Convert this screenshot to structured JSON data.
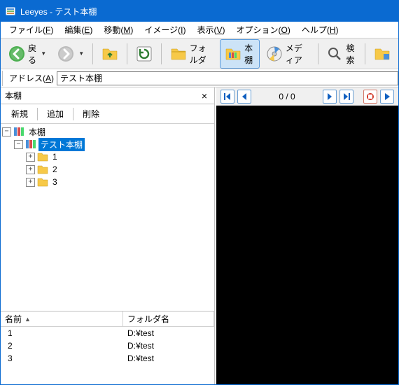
{
  "titlebar": {
    "title": "Leeyes - テスト本棚"
  },
  "menubar": {
    "file": "ファイル(",
    "file_u": "F",
    "file2": ")",
    "edit": "編集(",
    "edit_u": "E",
    "edit2": ")",
    "move": "移動(",
    "move_u": "M",
    "move2": ")",
    "image": "イメージ(",
    "image_u": "I",
    "image2": ")",
    "view": "表示(",
    "view_u": "V",
    "view2": ")",
    "option": "オプション(",
    "option_u": "O",
    "option2": ")",
    "help": "ヘルプ(",
    "help_u": "H",
    "help2": ")"
  },
  "toolbar": {
    "back": "戻る",
    "folder": "フォルダ",
    "bookshelf": "本棚",
    "media": "メディア",
    "search": "検索"
  },
  "addressbar": {
    "label_pre": "アドレス(",
    "label_u": "A",
    "label_post": ")",
    "value": "テスト本棚"
  },
  "sidebar": {
    "title": "本棚",
    "close": "×",
    "btn_new": "新規",
    "btn_add": "追加",
    "btn_del": "削除",
    "tree": {
      "root": "本棚",
      "selected": "テスト本棚",
      "children": [
        "1",
        "2",
        "3"
      ]
    }
  },
  "list": {
    "col_name": "名前",
    "col_folder": "フォルダ名",
    "rows": [
      {
        "name": "1",
        "folder": "D:¥test"
      },
      {
        "name": "2",
        "folder": "D:¥test"
      },
      {
        "name": "3",
        "folder": "D:¥test"
      }
    ]
  },
  "viewer": {
    "page": "0 / 0"
  }
}
